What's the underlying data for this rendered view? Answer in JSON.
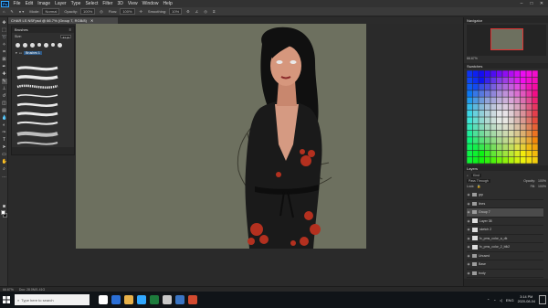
{
  "menubar": {
    "app_badge": "Ps",
    "items": [
      "File",
      "Edit",
      "Image",
      "Layer",
      "Type",
      "Select",
      "Filter",
      "3D",
      "View",
      "Window",
      "Help"
    ]
  },
  "optbar": {
    "mode_label": "Mode:",
    "mode_value": "Normal",
    "opacity_label": "Opacity:",
    "opacity_value": "100%",
    "flow_label": "Flow:",
    "flow_value": "100%",
    "smoothing_label": "Smoothing:",
    "smoothing_value": "10%"
  },
  "document_tab": {
    "title": "CHAR LS NSFpsd @ 66.7% (Group 7, RGB/8)"
  },
  "brushes_panel": {
    "title": "Brushes",
    "size_label": "Size:",
    "size_value": "21 px",
    "folder_label": "Brushes 1"
  },
  "navigator": {
    "title": "Navigator",
    "zoom": "66.67%"
  },
  "swatches": {
    "title": "Swatches",
    "colors": [
      "#ff0000",
      "#ff4000",
      "#ff8000",
      "#ffbf00",
      "#ffff00",
      "#bfff00",
      "#80ff00",
      "#00ff40",
      "#00ffbf",
      "#00bfff",
      "#0040ff",
      "#4000ff",
      "#8000ff",
      "#bf00ff",
      "#ff00bf",
      "#ff0040"
    ]
  },
  "layers": {
    "title": "Layers",
    "filter_label": "Kind",
    "blend_mode": "Pass Through",
    "opacity_label": "Opacity:",
    "opacity_value": "100%",
    "lock_label": "Lock:",
    "fill_label": "Fill:",
    "fill_value": "100%",
    "rows": [
      {
        "name": "grp",
        "type": "folder",
        "selected": false
      },
      {
        "name": "lines",
        "type": "folder",
        "selected": false
      },
      {
        "name": "Group 7",
        "type": "folder",
        "selected": true
      },
      {
        "name": "Layer 38",
        "type": "layer",
        "selected": false
      },
      {
        "name": "sketch 2",
        "type": "layer",
        "selected": false
      },
      {
        "name": "fx_pms_color_a_dk",
        "type": "layer",
        "selected": false
      },
      {
        "name": "fx_pms_color_2_blk2",
        "type": "layer",
        "selected": false
      },
      {
        "name": "Unused",
        "type": "folder",
        "selected": false
      },
      {
        "name": "Base",
        "type": "folder",
        "selected": false
      },
      {
        "name": "body",
        "type": "folder",
        "selected": false
      },
      {
        "name": "fx body 6 color 3rd",
        "type": "layer",
        "selected": false
      },
      {
        "name": "fx body 5 color 1st",
        "type": "layer",
        "selected": false
      },
      {
        "name": "Layer 1",
        "type": "layer",
        "selected": false
      }
    ]
  },
  "statusbar": {
    "zoom": "66.67%",
    "doc": "Doc: 28.0M/1.41G"
  },
  "taskbar": {
    "search_placeholder": "Type here to search",
    "language": "ENG",
    "time": "3:14 PM",
    "date": "2020-08-04",
    "icon_colors": [
      "#ffffff",
      "#2b6fd6",
      "#e8b24a",
      "#31a8ff",
      "#1d7b3c",
      "#c8c8c8",
      "#3a75c4",
      "#d24a2f"
    ]
  }
}
